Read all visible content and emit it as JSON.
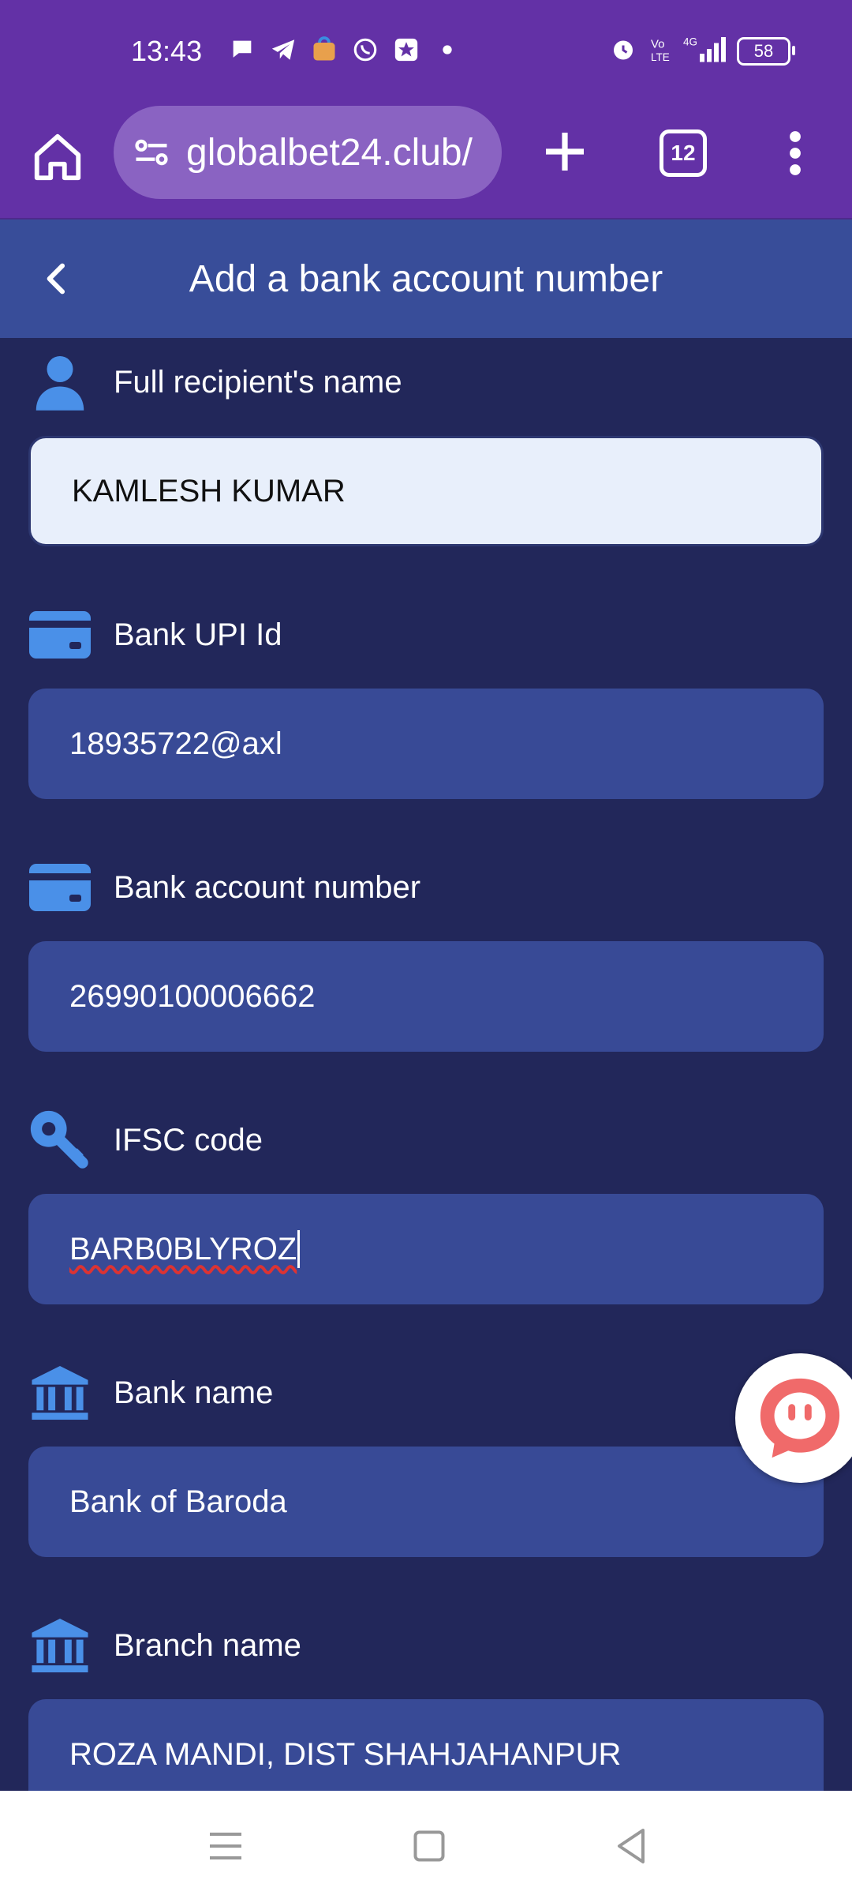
{
  "status_bar": {
    "time": "13:43",
    "notification_icons": [
      "chat-icon",
      "telegram-icon",
      "shopping-icon",
      "whatsapp-icon",
      "star-app-icon",
      "dot-icon"
    ],
    "status_icons": [
      "alarm-icon",
      "volte-icon",
      "signal-4g-icon"
    ],
    "battery": "58"
  },
  "browser": {
    "url": "globalbet24.club/",
    "tab_count": "12"
  },
  "header": {
    "title": "Add a bank account number"
  },
  "form": {
    "fields": [
      {
        "label": "Full recipient's name",
        "icon": "person-icon",
        "value": "KAMLESH KUMAR"
      },
      {
        "label": "Bank UPI Id",
        "icon": "card-icon",
        "value": "18935722@axl"
      },
      {
        "label": "Bank account number",
        "icon": "card-icon",
        "value": "26990100006662"
      },
      {
        "label": "IFSC code",
        "icon": "key-icon",
        "value": "BARB0BLYROZ"
      },
      {
        "label": "Bank name",
        "icon": "bank-icon",
        "value": "Bank of Baroda"
      },
      {
        "label": "Branch name",
        "icon": "bank-icon",
        "value": "ROZA MANDI, DIST SHAHJAHANPUR"
      }
    ]
  },
  "colors": {
    "browser_bar": "#6331a6",
    "page_background": "#22275a",
    "header_background": "#384d99",
    "field_background": "#384a96",
    "icon_accent": "#4a90e8",
    "chat_accent": "#f06a6a"
  }
}
